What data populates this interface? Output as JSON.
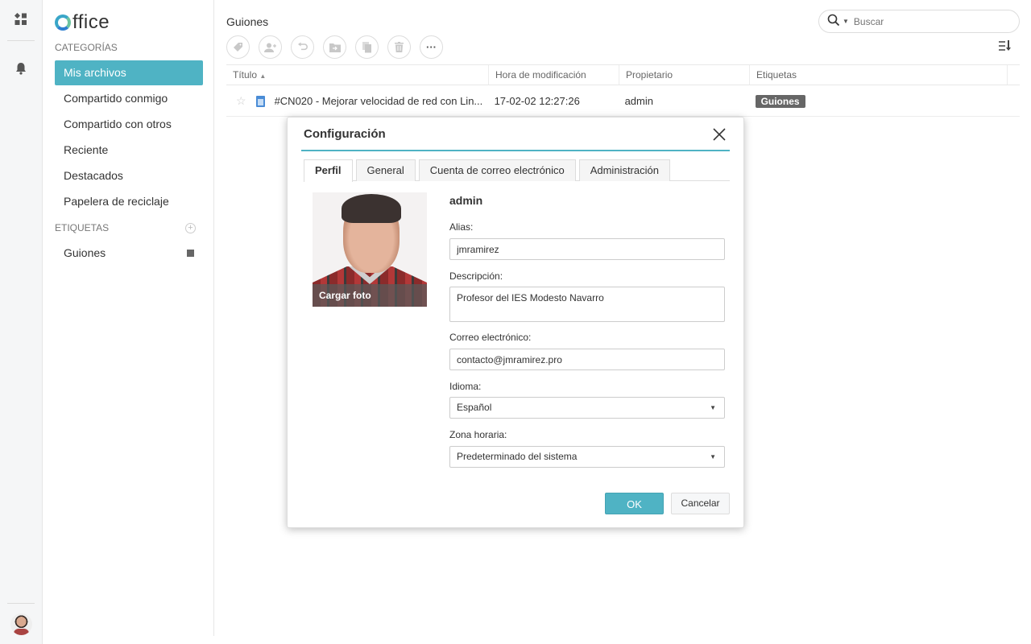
{
  "app": {
    "name": "Office",
    "brand_color": "#4fb3c4"
  },
  "rail": {
    "icons": [
      "apps-grid-icon",
      "bell-icon"
    ]
  },
  "sidebar": {
    "categories_heading": "CATEGORÍAS",
    "items": [
      {
        "label": "Mis archivos",
        "active": true
      },
      {
        "label": "Compartido conmigo"
      },
      {
        "label": "Compartido con otros"
      },
      {
        "label": "Reciente"
      },
      {
        "label": "Destacados"
      },
      {
        "label": "Papelera de reciclaje"
      }
    ],
    "tags_heading": "ETIQUETAS",
    "tags": [
      {
        "label": "Guiones"
      }
    ]
  },
  "header": {
    "title": "Guiones",
    "search_placeholder": "Buscar"
  },
  "toolbar": {
    "buttons": [
      "tag-icon",
      "share-user-icon",
      "undo-icon",
      "move-folder-icon",
      "copy-icon",
      "trash-icon",
      "more-icon"
    ],
    "more_label": "···"
  },
  "table": {
    "columns": [
      "Título",
      "Hora de modificación",
      "Propietario",
      "Etiquetas"
    ],
    "rows": [
      {
        "title": "#CN020 - Mejorar velocidad de red con Lin...",
        "modified": "17-02-02 12:27:26",
        "owner": "admin",
        "tag": "Guiones"
      }
    ]
  },
  "dialog": {
    "title": "Configuración",
    "tabs": [
      "Perfil",
      "General",
      "Cuenta de correo electrónico",
      "Administración"
    ],
    "active_tab": "Perfil",
    "photo_caption": "Cargar foto",
    "username": "admin",
    "fields": {
      "alias": {
        "label": "Alias:",
        "value": "jmramirez"
      },
      "description": {
        "label": "Descripción:",
        "value": "Profesor del IES Modesto Navarro"
      },
      "email": {
        "label": "Correo electrónico:",
        "value": "contacto@jmramirez.pro"
      },
      "language": {
        "label": "Idioma:",
        "value": "Español"
      },
      "timezone": {
        "label": "Zona horaria:",
        "value": "Predeterminado del sistema"
      }
    },
    "ok_label": "OK",
    "cancel_label": "Cancelar"
  }
}
